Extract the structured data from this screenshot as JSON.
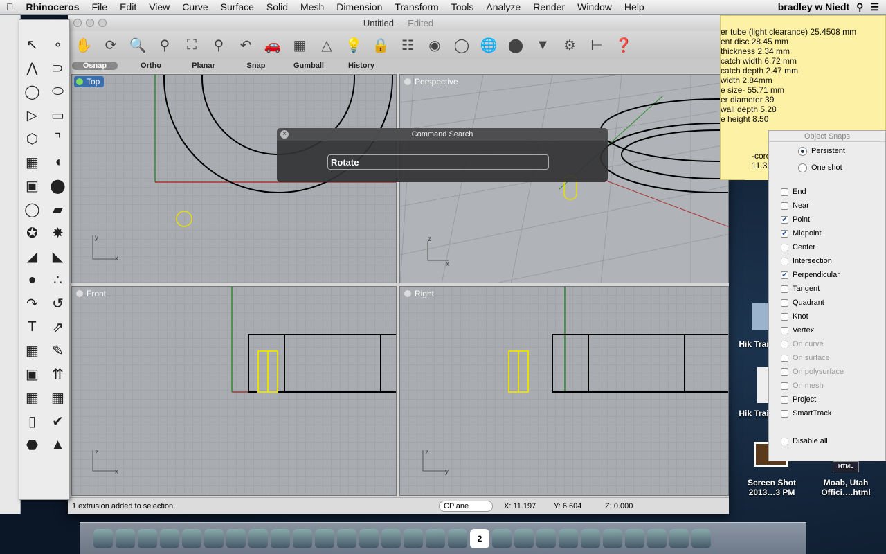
{
  "menubar": {
    "app": "Rhinoceros",
    "items": [
      "File",
      "Edit",
      "View",
      "Curve",
      "Surface",
      "Solid",
      "Mesh",
      "Dimension",
      "Transform",
      "Tools",
      "Analyze",
      "Render",
      "Window",
      "Help"
    ],
    "user": "bradley w Niedt"
  },
  "window": {
    "title": "Untitled",
    "edited": "— Edited"
  },
  "modes": [
    "Osnap",
    "Ortho",
    "Planar",
    "Snap",
    "Gumball",
    "History"
  ],
  "viewports": {
    "top": "Top",
    "perspective": "Perspective",
    "front": "Front",
    "right": "Right"
  },
  "command_search": {
    "title": "Command Search",
    "value": "Rotate"
  },
  "status": {
    "message": "1 extrusion added to selection.",
    "cplane": "CPlane",
    "x": "X: 11.197",
    "y": "Y: 6.604",
    "z": "Z: 0.000"
  },
  "sticky_lines": [
    "er tube (light clearance) 25.4508 mm",
    "ent disc 28.45 mm",
    " thickness 2.34 mm",
    "catch width 6.72 mm",
    "catch depth 2.47 mm",
    " width 2.84mm",
    "e size- 55.71 mm",
    "er diameter 39",
    " wall depth 5.28",
    "e height 8.50"
  ],
  "sticky2_lines": [
    "-corc",
    "11.35"
  ],
  "osnaps": {
    "title": "Object Snaps",
    "persistent": "Persistent",
    "one_shot": "One shot",
    "mode": "persistent",
    "items": [
      {
        "label": "End",
        "checked": false
      },
      {
        "label": "Near",
        "checked": false
      },
      {
        "label": "Point",
        "checked": true
      },
      {
        "label": "Midpoint",
        "checked": true
      },
      {
        "label": "Center",
        "checked": false
      },
      {
        "label": "Intersection",
        "checked": false
      },
      {
        "label": "Perpendicular",
        "checked": true
      },
      {
        "label": "Tangent",
        "checked": false
      },
      {
        "label": "Quadrant",
        "checked": false
      },
      {
        "label": "Knot",
        "checked": false
      },
      {
        "label": "Vertex",
        "checked": false
      },
      {
        "label": "On curve",
        "checked": false,
        "disabled": true
      },
      {
        "label": "On surface",
        "checked": false,
        "disabled": true
      },
      {
        "label": "On polysurface",
        "checked": false,
        "disabled": true
      },
      {
        "label": "On mesh",
        "checked": false,
        "disabled": true
      },
      {
        "label": "Project",
        "checked": false
      },
      {
        "label": "SmartTrack",
        "checked": false
      }
    ],
    "disable_all": "Disable all"
  },
  "desktop": {
    "icon1": "Hik Trail",
    "icon2": "Hik Trail",
    "screenshot": "Screen Shot 2013…3 PM",
    "moab": "Moab, Utah Offici….html"
  },
  "dock_date": "2",
  "colors": {
    "viewport_bg": "#a9acb1",
    "active_label": "#3a6fae",
    "sticky": "#fdf1a5",
    "selection": "#e8e000"
  }
}
